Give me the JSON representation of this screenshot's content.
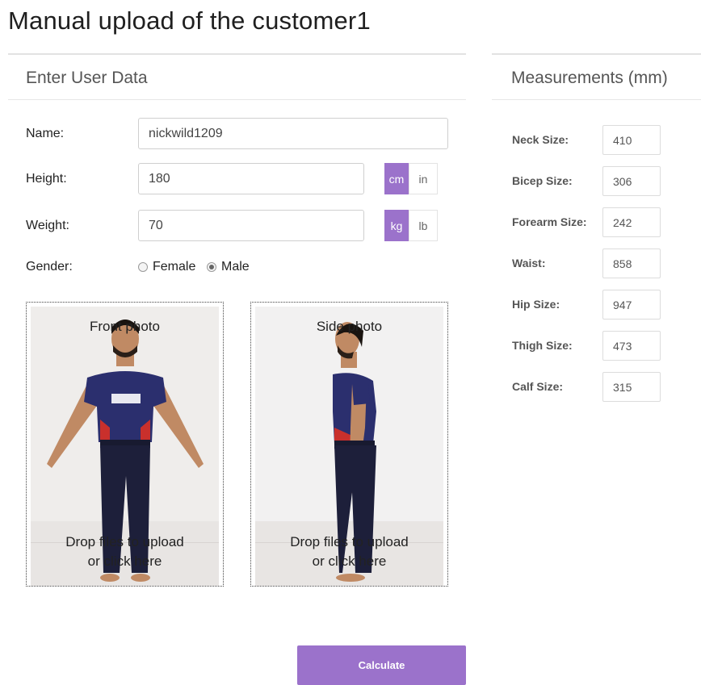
{
  "page": {
    "title": "Manual upload of the customer1"
  },
  "user_panel": {
    "heading": "Enter User Data",
    "name": {
      "label": "Name:",
      "value": "nickwild1209"
    },
    "height": {
      "label": "Height:",
      "value": "180",
      "units": [
        "cm",
        "in"
      ],
      "selected_unit": "cm"
    },
    "weight": {
      "label": "Weight:",
      "value": "70",
      "units": [
        "kg",
        "lb"
      ],
      "selected_unit": "kg"
    },
    "gender": {
      "label": "Gender:",
      "options": [
        "Female",
        "Male"
      ],
      "selected": "Male"
    },
    "front_dropzone": {
      "title": "Front photo",
      "message_line1": "Drop files to upload",
      "message_line2": "or click here"
    },
    "side_dropzone": {
      "title": "Side photo",
      "message_line1": "Drop files to upload",
      "message_line2": "or click here"
    },
    "calculate_label": "Calculate"
  },
  "measurements_panel": {
    "heading": "Measurements (mm)",
    "items": [
      {
        "label": "Neck Size:",
        "value": "410"
      },
      {
        "label": "Bicep Size:",
        "value": "306"
      },
      {
        "label": "Forearm Size:",
        "value": "242"
      },
      {
        "label": "Waist:",
        "value": "858"
      },
      {
        "label": "Hip Size:",
        "value": "947"
      },
      {
        "label": "Thigh Size:",
        "value": "473"
      },
      {
        "label": "Calf Size:",
        "value": "315"
      }
    ]
  },
  "colors": {
    "accent": "#9b72cb",
    "shirt": "#2b2f6e",
    "pants": "#1d1f3a",
    "skin": "#c08a64"
  }
}
